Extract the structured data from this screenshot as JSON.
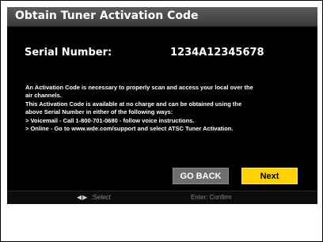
{
  "dialog": {
    "title": "Obtain Tuner Activation Code",
    "serial_label": "Serial Number:",
    "serial_value": "1234A12345678",
    "body_lines": [
      "An Activation Code is necessary to properly scan and access your local over the",
      "air channels.",
      "This Activation Code is available at no charge and can be obtained using the",
      "above Serial Number in either of the following ways:",
      "  > Voicemail - Call 1-800-701-0680 - follow voice instructions.",
      "  > Online - Go to www.wde.com/support and select ATSC Tuner Activation."
    ],
    "buttons": {
      "back_label": "GO BACK",
      "next_label": "Next"
    },
    "footer": {
      "select_arrows": "◀▶",
      "select_hint": ":Select",
      "confirm_hint": "Enter: Confirm"
    }
  },
  "colors": {
    "dialog_bg": "#000000",
    "title_bar": "#4a4a4a",
    "next_button": "#ffd200",
    "back_button": "#6e6e6e",
    "hint_text": "#8a8a8a"
  }
}
